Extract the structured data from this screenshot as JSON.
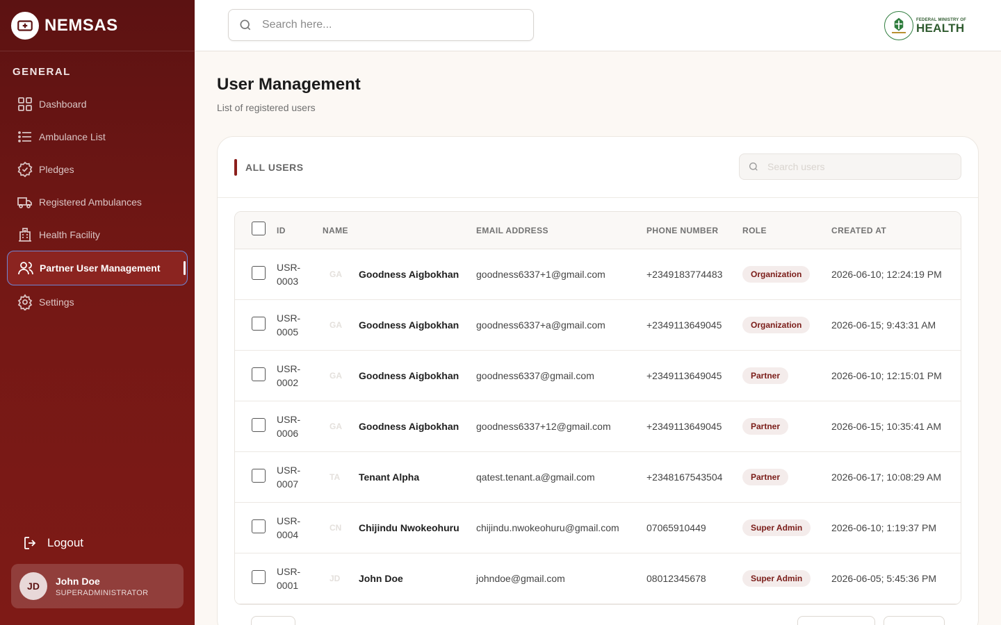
{
  "brand": {
    "name": "NEMSAS"
  },
  "sidebar": {
    "section": "GENERAL",
    "items": [
      {
        "label": "Dashboard",
        "icon": "grid-icon"
      },
      {
        "label": "Ambulance List",
        "icon": "list-icon"
      },
      {
        "label": "Pledges",
        "icon": "badge-check-icon"
      },
      {
        "label": "Registered Ambulances",
        "icon": "truck-icon"
      },
      {
        "label": "Health Facility",
        "icon": "hospital-icon"
      },
      {
        "label": "Partner User Management",
        "icon": "users-icon",
        "active": true
      },
      {
        "label": "Settings",
        "icon": "gear-icon"
      }
    ],
    "logout": "Logout",
    "user": {
      "initials": "JD",
      "name": "John Doe",
      "role": "SUPERADMINISTRATOR"
    }
  },
  "topbar": {
    "search_placeholder": "Search here...",
    "ministry_small": "FEDERAL MINISTRY OF",
    "ministry_big": "HEALTH"
  },
  "page": {
    "title": "User Management",
    "subtitle": "List of registered users"
  },
  "card": {
    "title": "ALL USERS",
    "search_placeholder": "Search users"
  },
  "table": {
    "headers": {
      "id": "ID",
      "name": "NAME",
      "email": "EMAIL ADDRESS",
      "phone": "PHONE NUMBER",
      "role": "ROLE",
      "created": "CREATED AT"
    },
    "rows": [
      {
        "id": "USR-0003",
        "initials": "GA",
        "name": "Goodness Aigbokhan",
        "email": "goodness6337+1@gmail.com",
        "phone": "+2349183774483",
        "role": "Organization",
        "created": "2026-06-10; 12:24:19 PM"
      },
      {
        "id": "USR-0005",
        "initials": "GA",
        "name": "Goodness Aigbokhan",
        "email": "goodness6337+a@gmail.com",
        "phone": "+2349113649045",
        "role": "Organization",
        "created": "2026-06-15; 9:43:31 AM"
      },
      {
        "id": "USR-0002",
        "initials": "GA",
        "name": "Goodness Aigbokhan",
        "email": "goodness6337@gmail.com",
        "phone": "+2349113649045",
        "role": "Partner",
        "created": "2026-06-10; 12:15:01 PM"
      },
      {
        "id": "USR-0006",
        "initials": "GA",
        "name": "Goodness Aigbokhan",
        "email": "goodness6337+12@gmail.com",
        "phone": "+2349113649045",
        "role": "Partner",
        "created": "2026-06-15; 10:35:41 AM"
      },
      {
        "id": "USR-0007",
        "initials": "TA",
        "name": "Tenant Alpha",
        "email": "qatest.tenant.a@gmail.com",
        "phone": "+2348167543504",
        "role": "Partner",
        "created": "2026-06-17; 10:08:29 AM"
      },
      {
        "id": "USR-0004",
        "initials": "CN",
        "name": "Chijindu Nwokeohuru",
        "email": "chijindu.nwokeohuru@gmail.com",
        "phone": "07065910449",
        "role": "Super Admin",
        "created": "2026-06-10; 1:19:37 PM"
      },
      {
        "id": "USR-0001",
        "initials": "JD",
        "name": "John Doe",
        "email": "johndoe@gmail.com",
        "phone": "08012345678",
        "role": "Super Admin",
        "created": "2026-06-05; 5:45:36 PM"
      }
    ]
  },
  "colors": {
    "sidebar": "#741815",
    "accent": "#8b1f1c",
    "badge_bg": "#f4eceb",
    "badge_text": "#7a1c18"
  }
}
